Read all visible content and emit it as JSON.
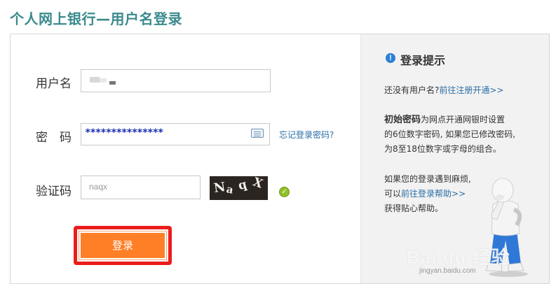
{
  "title": "个人网上银行—用户名登录",
  "form": {
    "username_label": "用户名",
    "password_label": "密　码",
    "password_value": "***************",
    "forgot_password": "忘记登录密码?",
    "captcha_label": "验证码",
    "captcha_input_value": "naqx",
    "captcha_chars": [
      "N",
      "a",
      "q",
      "X"
    ],
    "login_button": "登录"
  },
  "tips": {
    "title": "登录提示",
    "no_account_text": "还没有用户名?",
    "register_link": "前往注册开通>>",
    "initial_pw_bold": "初始密码",
    "initial_pw_line1": "为网点开通网银时设置",
    "initial_pw_line2": "的6位数字密码, 如果您已修改密码,",
    "initial_pw_line3": "为8至18位数字或字母的组合。",
    "trouble_line1": "如果您的登录遇到麻烦,",
    "trouble_prefix": "可以",
    "help_link": "前往登录帮助>>",
    "trouble_line3": "获得贴心帮助。"
  },
  "colors": {
    "title": "#3a8a8c",
    "link": "#2a6ea6",
    "login_button": "#ff7f27",
    "highlight_border": "#ec1c1c"
  },
  "icons": [
    "keyboard-icon",
    "check-icon",
    "info-icon"
  ]
}
